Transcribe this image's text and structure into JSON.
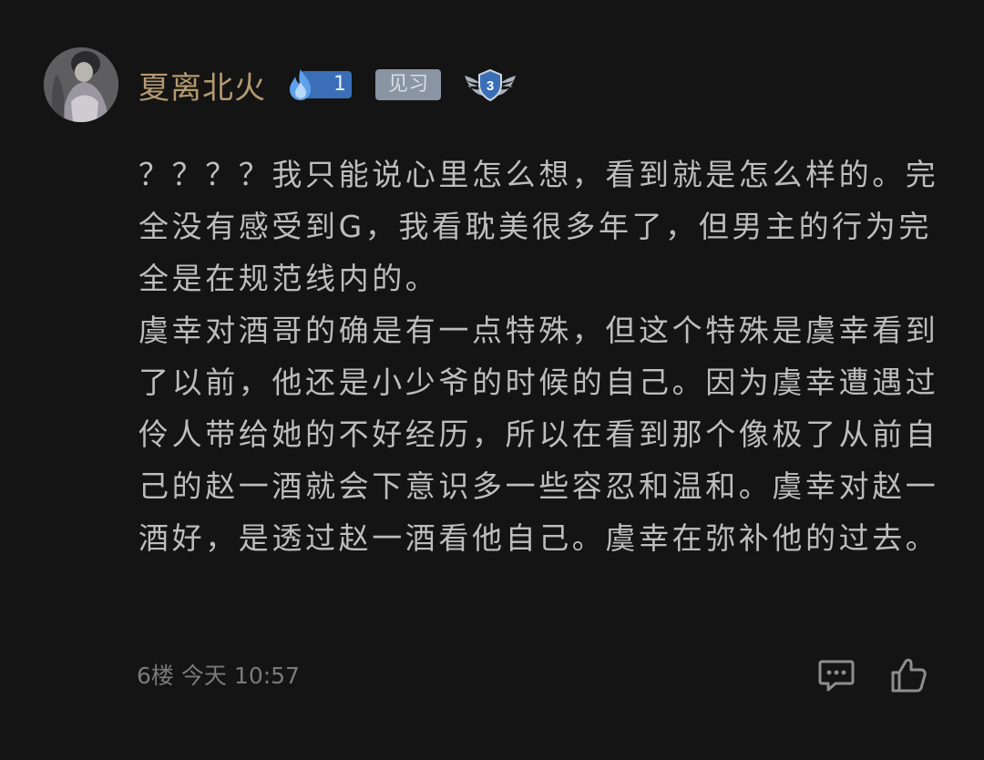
{
  "user": {
    "name": "夏离北火",
    "fire_level": "1",
    "rank_label": "见习",
    "shield_level": "3"
  },
  "post": {
    "paragraphs": [
      "？？？？我只能说心里怎么想，看到就是怎么样的。完全没有感受到G，我看耽美很多年了，但男主的行为完全是在规范线内的。",
      "虞幸对酒哥的确是有一点特殊，但这个特殊是虞幸看到了以前，他还是小少爷的时候的自己。因为虞幸遭遇过伶人带给她的不好经历，所以在看到那个像极了从前自己的赵一酒就会下意识多一些容忍和温和。虞幸对赵一酒好，是透过赵一酒看他自己。虞幸在弥补他的过去。"
    ]
  },
  "footer": {
    "floor": "6楼",
    "date": "今天",
    "time": "10:57"
  },
  "colors": {
    "background": "#141414",
    "username": "#b59a6f",
    "content_text": "#bdbdbd",
    "meta_text": "#7a7a7a",
    "fire_badge": "#3a6fb8",
    "rank_badge": "#8a95a3"
  },
  "icons": {
    "fire": "flame-icon",
    "shield": "shield-wings-icon",
    "comment": "comment-icon",
    "like": "thumbs-up-icon"
  }
}
